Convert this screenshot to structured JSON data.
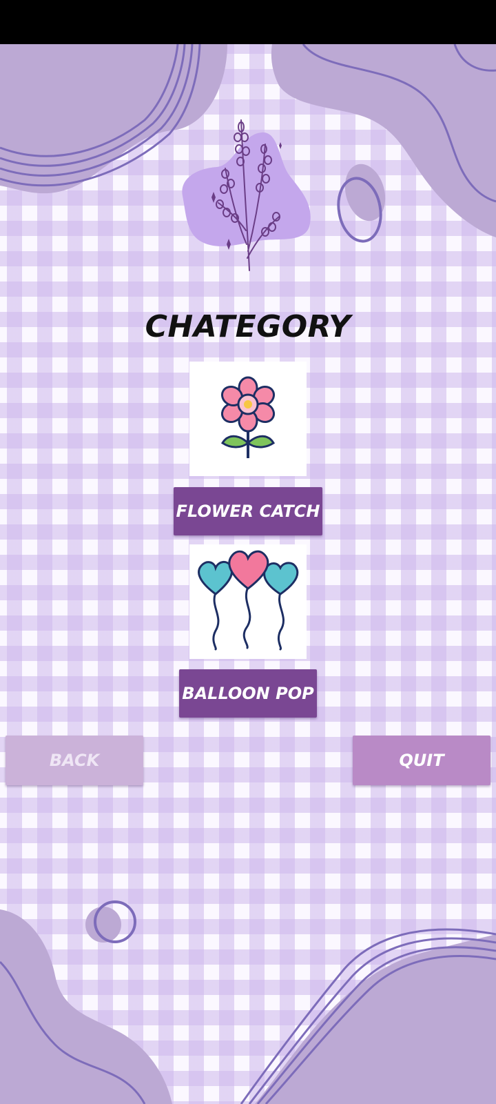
{
  "screen": {
    "title": "CHATEGORY",
    "logo_icon": "lavender-sprig-icon"
  },
  "categories": [
    {
      "label": "FLOWER CATCH",
      "icon": "flower-icon"
    },
    {
      "label": "BALLOON POP",
      "icon": "heart-balloons-icon"
    }
  ],
  "nav": {
    "back_label": "BACK",
    "quit_label": "QUIT"
  },
  "colors": {
    "primary_button": "#7a4793",
    "quit_button": "#b98ac6",
    "back_button_disabled": "#cbb2d9",
    "blob": "#bca9d4",
    "wave_line": "#7d6cba",
    "grid_stripe": "#d8c8ef"
  }
}
